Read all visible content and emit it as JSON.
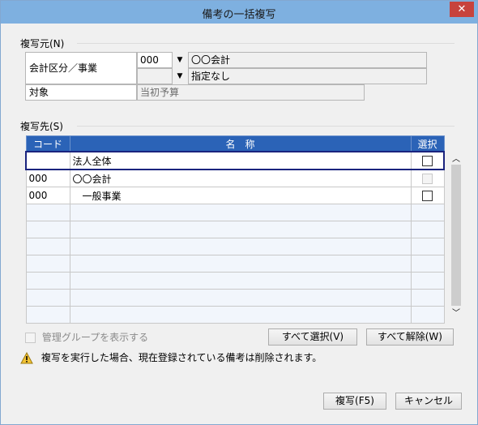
{
  "window": {
    "title": "備考の一括複写",
    "close_glyph": "✕"
  },
  "source": {
    "group_label": "複写元(N)",
    "dept_label": "会計区分／事業",
    "dept_code": "000",
    "dept_name": "〇〇会計",
    "business_code": "",
    "business_name": "指定なし",
    "target_label": "対象",
    "target_value": "当初予算"
  },
  "dest": {
    "group_label": "複写先(S)",
    "columns": {
      "code": "コード",
      "name": "名　称",
      "select": "選択"
    },
    "rows": [
      {
        "code": "",
        "name": "法人全体",
        "checked": false,
        "enabled": false,
        "selected": true
      },
      {
        "code": "000",
        "name": "〇〇会計",
        "checked": false,
        "enabled": false
      },
      {
        "code": "000",
        "name": "　一般事業",
        "checked": false,
        "enabled": true
      }
    ]
  },
  "options": {
    "show_groups_label": "管理グループを表示する",
    "show_groups_checked": false
  },
  "buttons": {
    "select_all": "すべて選択(V)",
    "deselect_all": "すべて解除(W)",
    "copy": "複写(F5)",
    "cancel": "キャンセル"
  },
  "warning": {
    "text": "複写を実行した場合、現在登録されている備考は削除されます。",
    "icon": "warning-icon"
  },
  "colors": {
    "accent": "#2b63b7",
    "selection_border": "#1a237e",
    "titlebar": "#7eb0e0",
    "close": "#c7433d"
  }
}
